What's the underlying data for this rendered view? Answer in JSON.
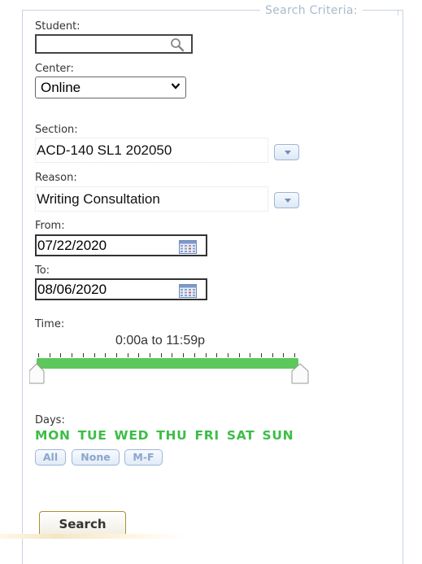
{
  "panel": {
    "legend": "Search Criteria:"
  },
  "student": {
    "label": "Student:",
    "value": ""
  },
  "center": {
    "label": "Center:",
    "selected": "Online"
  },
  "section": {
    "label": "Section:",
    "value": "ACD-140 SL1 202050"
  },
  "reason": {
    "label": "Reason:",
    "value": "Writing Consultation"
  },
  "from": {
    "label": "From:",
    "value": "07/22/2020"
  },
  "to": {
    "label": "To:",
    "value": "08/06/2020"
  },
  "time": {
    "label": "Time:",
    "range_text": "0:00a to 11:59p",
    "start": "0:00a",
    "end": "11:59p",
    "fill_fraction": 1.0
  },
  "days": {
    "label": "Days:",
    "items": [
      "MON",
      "TUE",
      "WED",
      "THU",
      "FRI",
      "SAT",
      "SUN"
    ],
    "all_label": "All",
    "none_label": "None",
    "mf_label": "M-F",
    "active_color": "#3cbe47"
  },
  "search_button": "Search",
  "icons": {
    "student_lookup": "magnifier-icon",
    "date_picker": "calendar-icon",
    "dropdown": "dropdown-arrow-icon"
  }
}
